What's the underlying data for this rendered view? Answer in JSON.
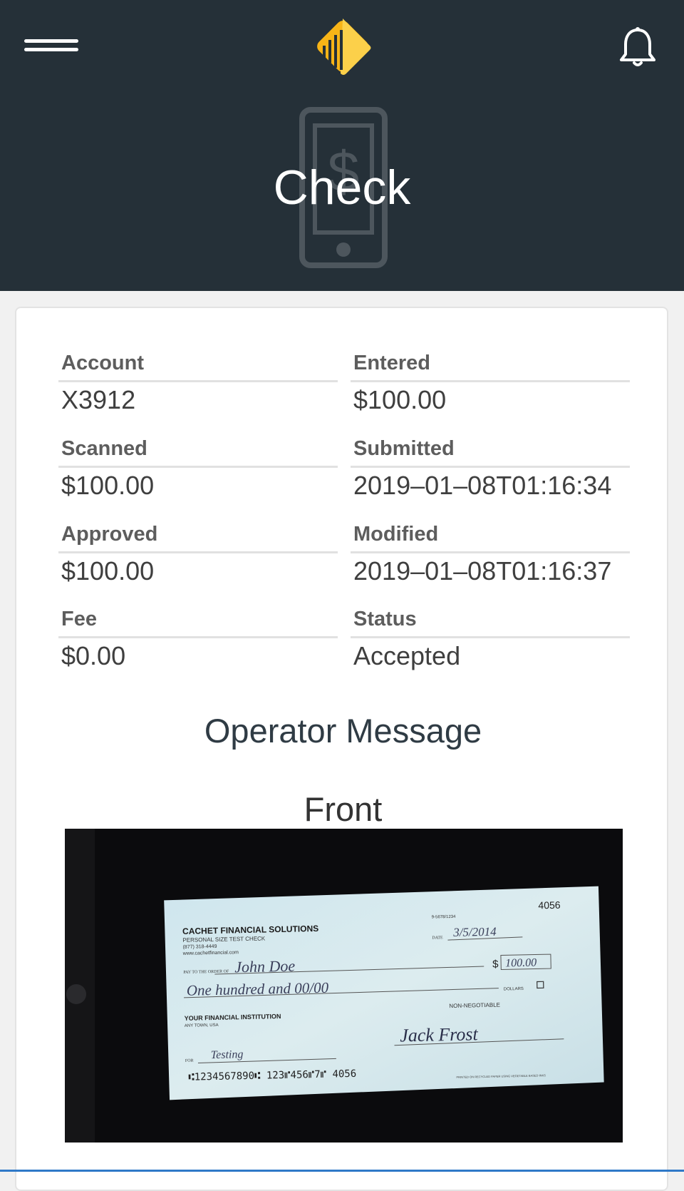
{
  "header": {
    "title": "Check",
    "icons": {
      "menu": "hamburger-menu-icon",
      "logo": "brand-logo-icon",
      "notifications": "bell-icon",
      "watermark": "mobile-dollar-icon"
    },
    "colors": {
      "background": "#253038",
      "logo_primary": "#f7b417",
      "logo_secondary": "#fcd04a"
    }
  },
  "details": {
    "account": {
      "label": "Account",
      "value": "X3912"
    },
    "entered": {
      "label": "Entered",
      "value": "$100.00"
    },
    "scanned": {
      "label": "Scanned",
      "value": "$100.00"
    },
    "submitted": {
      "label": "Submitted",
      "value": "2019–01–08T01:16:34"
    },
    "approved": {
      "label": "Approved",
      "value": "$100.00"
    },
    "modified": {
      "label": "Modified",
      "value": "2019–01–08T01:16:37"
    },
    "fee": {
      "label": "Fee",
      "value": "$0.00"
    },
    "status": {
      "label": "Status",
      "value": "Accepted"
    }
  },
  "operator_message": {
    "title": "Operator Message"
  },
  "front": {
    "title": "Front",
    "check": {
      "number": "4056",
      "company": "CACHET FINANCIAL SOLUTIONS",
      "subtitle": "PERSONAL SIZE TEST CHECK",
      "phone": "(877) 318-4449",
      "website": "www.cachetfinancial.com",
      "routing_fraction": "9-5678/1234",
      "date_label": "DATE",
      "date": "3/5/2014",
      "pay_to_label": "PAY TO THE ORDER OF",
      "payee": "John Doe",
      "amount": "100.00",
      "written_amount": "One hundred and 00/00",
      "dollars_label": "DOLLARS",
      "bank": "YOUR FINANCIAL INSTITUTION",
      "bank_city": "ANY TOWN, USA",
      "non_negotiable": "NON-NEGOTIABLE",
      "for_label": "FOR",
      "memo": "Testing",
      "signature": "Jack Frost",
      "micr": "⑆1234567890⑆ 123⑈456⑈7⑈ 4056",
      "footer": "PRINTED ON RECYCLED PAPER USING VEGETABLE BASED INKS"
    }
  }
}
